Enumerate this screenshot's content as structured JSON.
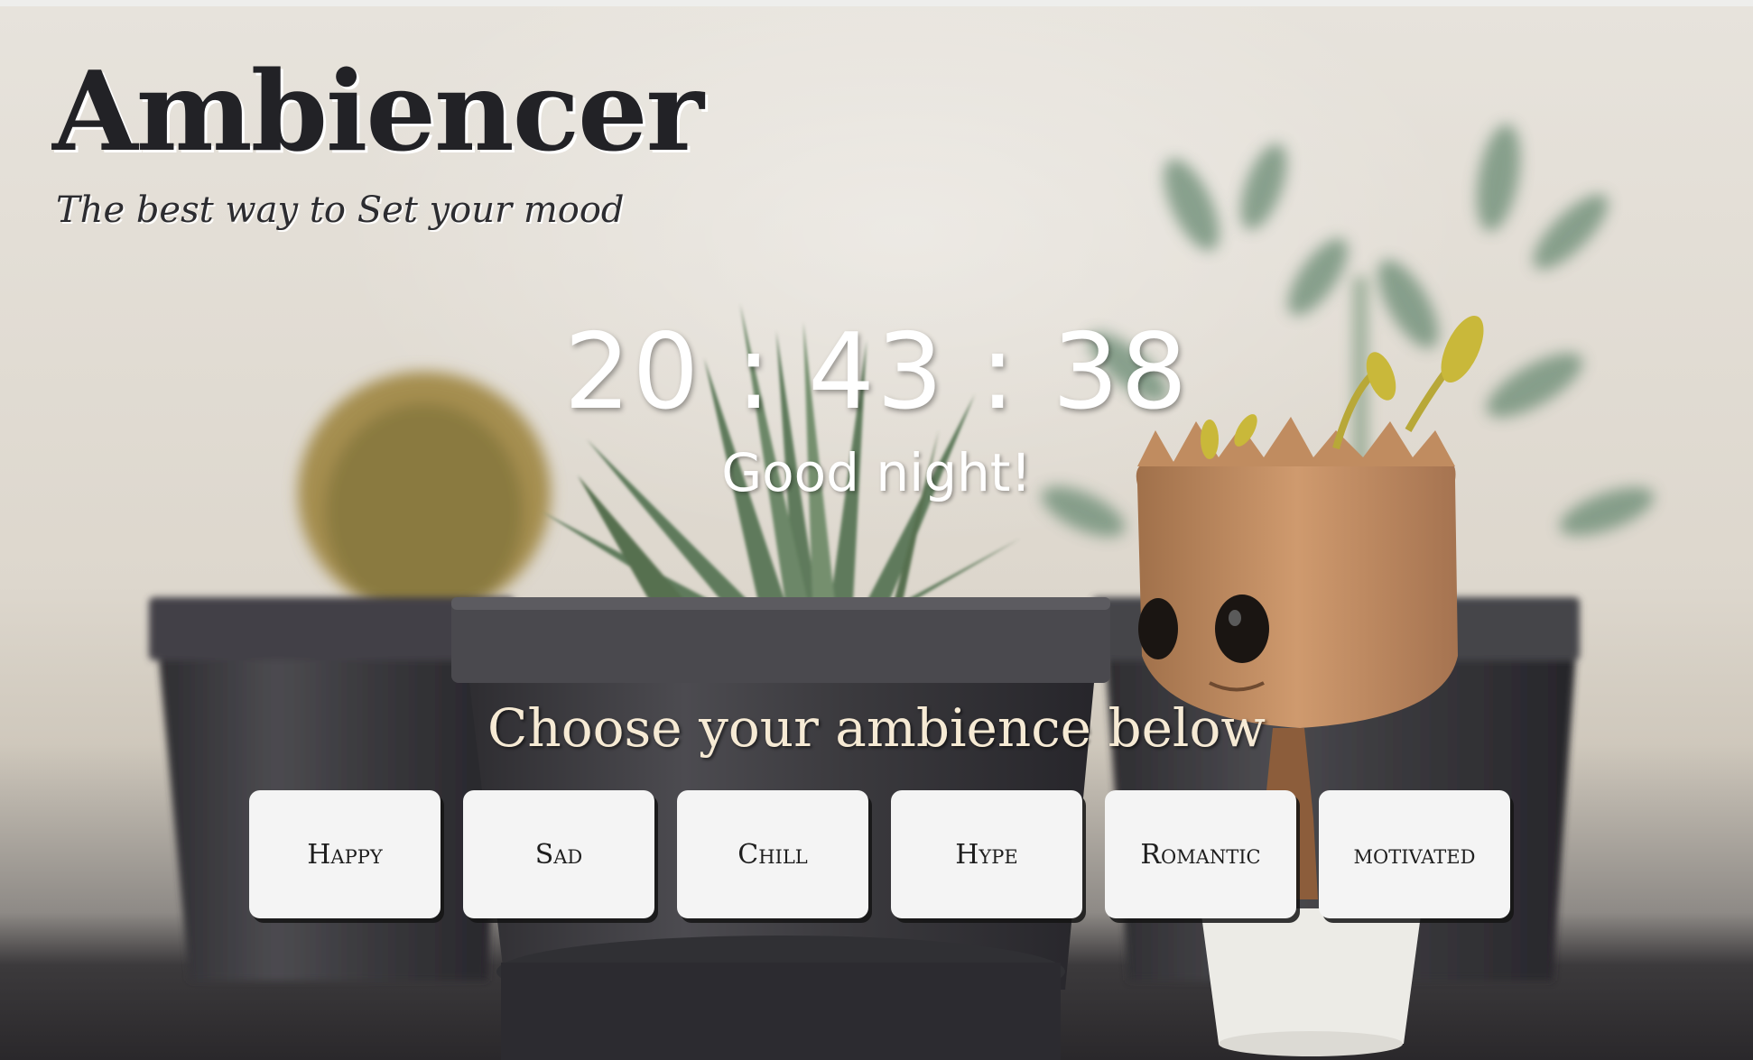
{
  "app": {
    "title": "Ambiencer",
    "tagline": "The best way to Set your mood"
  },
  "clock": {
    "time": "20 : 43 : 38",
    "greeting": "Good night!"
  },
  "ambience": {
    "prompt": "Choose your ambience below",
    "options": [
      {
        "label": "Happy"
      },
      {
        "label": "Sad"
      },
      {
        "label": "Chill"
      },
      {
        "label": "Hype"
      },
      {
        "label": "Romantic"
      },
      {
        "label": "motivated"
      }
    ]
  },
  "background": {
    "description_icon": "potted-plants-photo-icon",
    "palette": {
      "wall": "#e3ded5",
      "pot": "#3a393c",
      "table": "#2a282b",
      "accent_text": "#f6ead4"
    }
  }
}
